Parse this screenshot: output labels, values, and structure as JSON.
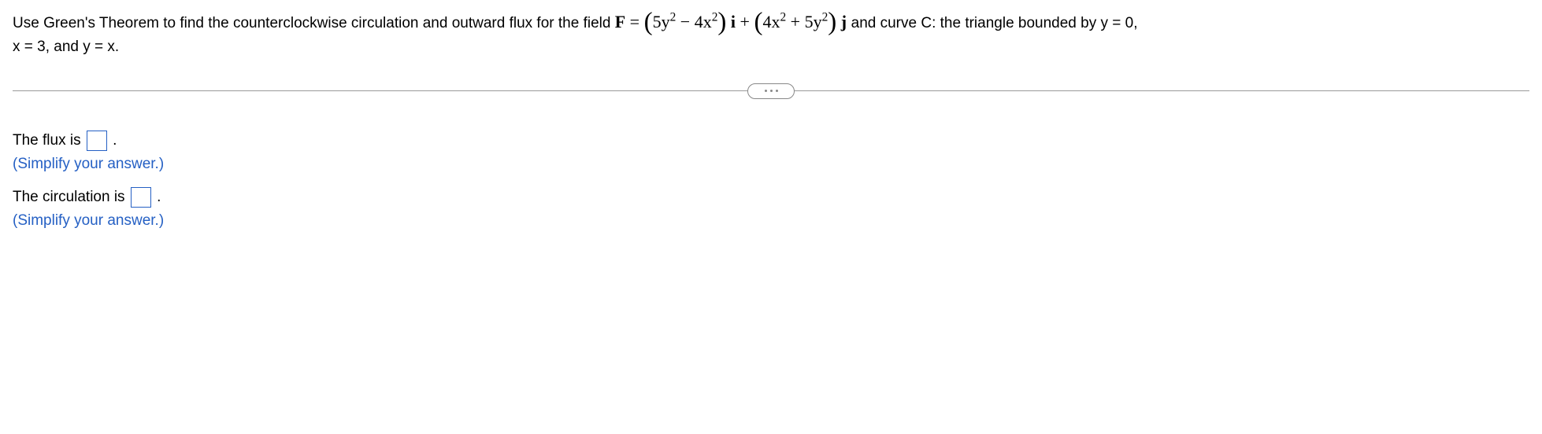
{
  "problem": {
    "prefix": "Use Green's Theorem to find the counterclockwise circulation and outward flux for the field ",
    "vector_label": "F",
    "equals": " = ",
    "term1_open": "(",
    "term1_a": "5y",
    "term1_exp_a": "2",
    "term1_minus": " − 4x",
    "term1_exp_b": "2",
    "term1_close": ")",
    "i_label": " i ",
    "plus": "+ ",
    "term2_open": "(",
    "term2_a": "4x",
    "term2_exp_a": "2",
    "term2_plus": " + 5y",
    "term2_exp_b": "2",
    "term2_close": ")",
    "j_label": " j ",
    "suffix1": "and curve C: the triangle bounded by y = 0,",
    "suffix2": "x = 3, and y = x."
  },
  "answers": {
    "flux_label": "The flux is ",
    "flux_period": ".",
    "hint1": "(Simplify your answer.)",
    "circulation_label": "The circulation is ",
    "circulation_period": ".",
    "hint2": "(Simplify your answer.)"
  }
}
